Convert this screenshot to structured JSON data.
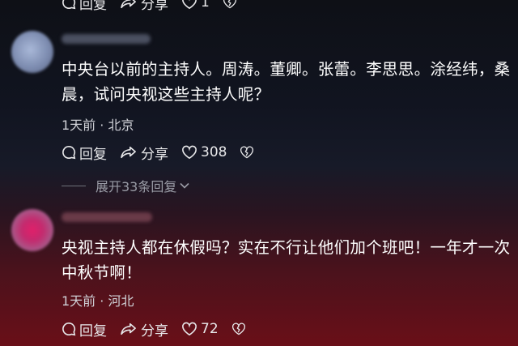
{
  "top_actions": {
    "reply": "回复",
    "share": "分享",
    "likes": "1"
  },
  "comments": [
    {
      "text": "中央台以前的主持人。周涛。董卿。张蕾。李思思。涂经纬，桑晨，试问央视这些主持人呢？",
      "time": "1天前",
      "location": "北京",
      "reply_label": "回复",
      "share_label": "分享",
      "likes": "308"
    },
    {
      "text": "央视主持人都在休假吗？实在不行让他们加个班吧！一年才一次中秋节啊！",
      "time": "1天前",
      "location": "河北",
      "reply_label": "回复",
      "share_label": "分享",
      "likes": "72"
    }
  ],
  "expand_replies": "展开33条回复",
  "colors": {
    "accent_text": "#ffffff",
    "meta_text": "#cfd0d6",
    "bg_bottom": "#6a0f18"
  },
  "icons": [
    "comment-icon",
    "share-icon",
    "heart-icon",
    "broken-heart-icon",
    "chevron-down-icon"
  ]
}
